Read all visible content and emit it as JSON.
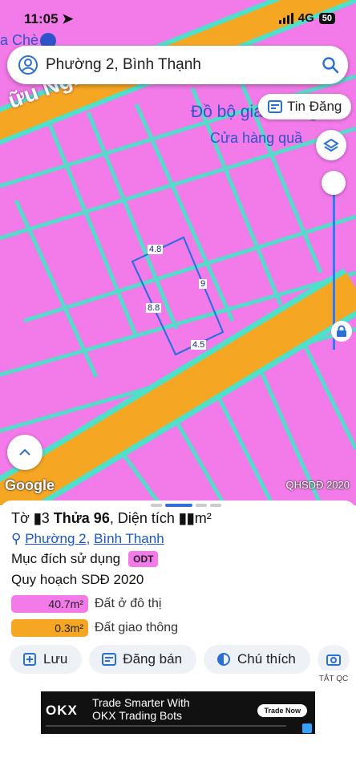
{
  "status_bar": {
    "time": "11:05",
    "network": "4G",
    "battery": "50"
  },
  "map": {
    "top_poi": "a Chè",
    "street_label": "ữu Nghĩa",
    "poi_line1": "Đồ bộ gia hương",
    "poi_line2": "Cửa hàng quầ",
    "parcel_dims": {
      "top": "4.8",
      "right": "9",
      "left": "8.8",
      "bottom": "4.5"
    },
    "google_logo": "Google",
    "plan_label": "QHSDĐ 2020",
    "colors": {
      "residential": "#f27ae9",
      "road": "#f5a623",
      "boundary": "#4ee0c8"
    }
  },
  "search": {
    "value": "Phường 2, Bình Thạnh"
  },
  "tin_dang": {
    "label": "Tin Đăng"
  },
  "sheet": {
    "title_prefix": "Tờ",
    "sheet_no": "3",
    "parcel_label": "Thửa 96",
    "area_label": ", Diện tích",
    "area_unit": "m²",
    "ward": "Phường 2",
    "district": "Bình Thạnh",
    "purpose_label": "Mục đích sử dụng",
    "purpose_code": "ODT",
    "plan_title": "Quy hoạch SDĐ 2020",
    "land_uses": [
      {
        "area": "40.7m²",
        "label": "Đất ở đô thị",
        "color": "#f27ae9"
      },
      {
        "area": "0.3m²",
        "label": "Đất giao thông",
        "color": "#f5a623"
      }
    ],
    "actions": [
      "Lưu",
      "Đăng bán",
      "Chú thích"
    ]
  },
  "ad": {
    "close_label": "TẮT QC",
    "logo": "OKX",
    "headline_line1": "Trade Smarter With",
    "headline_line2": "OKX Trading Bots",
    "cta": "Trade Now"
  }
}
